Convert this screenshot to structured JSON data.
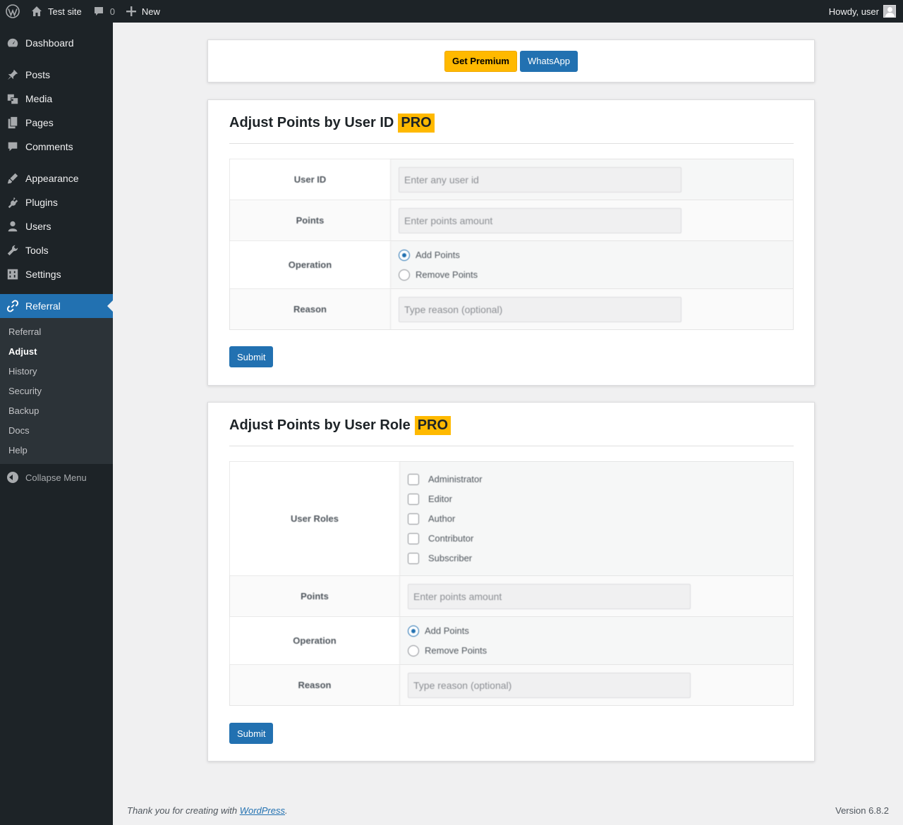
{
  "adminbar": {
    "site_name": "Test site",
    "comments_count": "0",
    "new_label": "New",
    "howdy": "Howdy, user"
  },
  "sidebar": {
    "items": [
      {
        "label": "Dashboard",
        "icon": "dashboard-icon"
      },
      {
        "label": "Posts",
        "icon": "pin-icon"
      },
      {
        "label": "Media",
        "icon": "media-icon"
      },
      {
        "label": "Pages",
        "icon": "pages-icon"
      },
      {
        "label": "Comments",
        "icon": "comment-icon"
      },
      {
        "label": "Appearance",
        "icon": "brush-icon"
      },
      {
        "label": "Plugins",
        "icon": "plug-icon"
      },
      {
        "label": "Users",
        "icon": "user-icon"
      },
      {
        "label": "Tools",
        "icon": "wrench-icon"
      },
      {
        "label": "Settings",
        "icon": "settings-icon"
      },
      {
        "label": "Referral",
        "icon": "link-icon"
      }
    ],
    "submenu": [
      "Referral",
      "Adjust",
      "History",
      "Security",
      "Backup",
      "Docs",
      "Help"
    ],
    "current_submenu": "Adjust",
    "collapse_label": "Collapse Menu"
  },
  "top_buttons": {
    "premium": "Get Premium",
    "whatsapp": "WhatsApp"
  },
  "colors": {
    "accent": "#2271b1",
    "pro_badge": "#ffb900",
    "sidebar_bg": "#1d2327"
  },
  "by_id": {
    "title": "Adjust Points by User ID",
    "badge": "PRO",
    "user_id_label": "User ID",
    "user_id_placeholder": "Enter any user id",
    "points_label": "Points",
    "points_placeholder": "Enter points amount",
    "operation_label": "Operation",
    "operations": [
      "Add Points",
      "Remove Points"
    ],
    "selected_operation": "Add Points",
    "reason_label": "Reason",
    "reason_placeholder": "Type reason (optional)",
    "submit": "Submit"
  },
  "by_role": {
    "title": "Adjust Points by User Role",
    "badge": "PRO",
    "roles_label": "User Roles",
    "roles": [
      "Administrator",
      "Editor",
      "Author",
      "Contributor",
      "Subscriber"
    ],
    "points_label": "Points",
    "points_placeholder": "Enter points amount",
    "operation_label": "Operation",
    "operations": [
      "Add Points",
      "Remove Points"
    ],
    "selected_operation": "Add Points",
    "reason_label": "Reason",
    "reason_placeholder": "Type reason (optional)",
    "submit": "Submit"
  },
  "footer": {
    "thanks_prefix": "Thank you for creating with ",
    "thanks_link": "WordPress",
    "thanks_suffix": ".",
    "version": "Version 6.8.2"
  }
}
